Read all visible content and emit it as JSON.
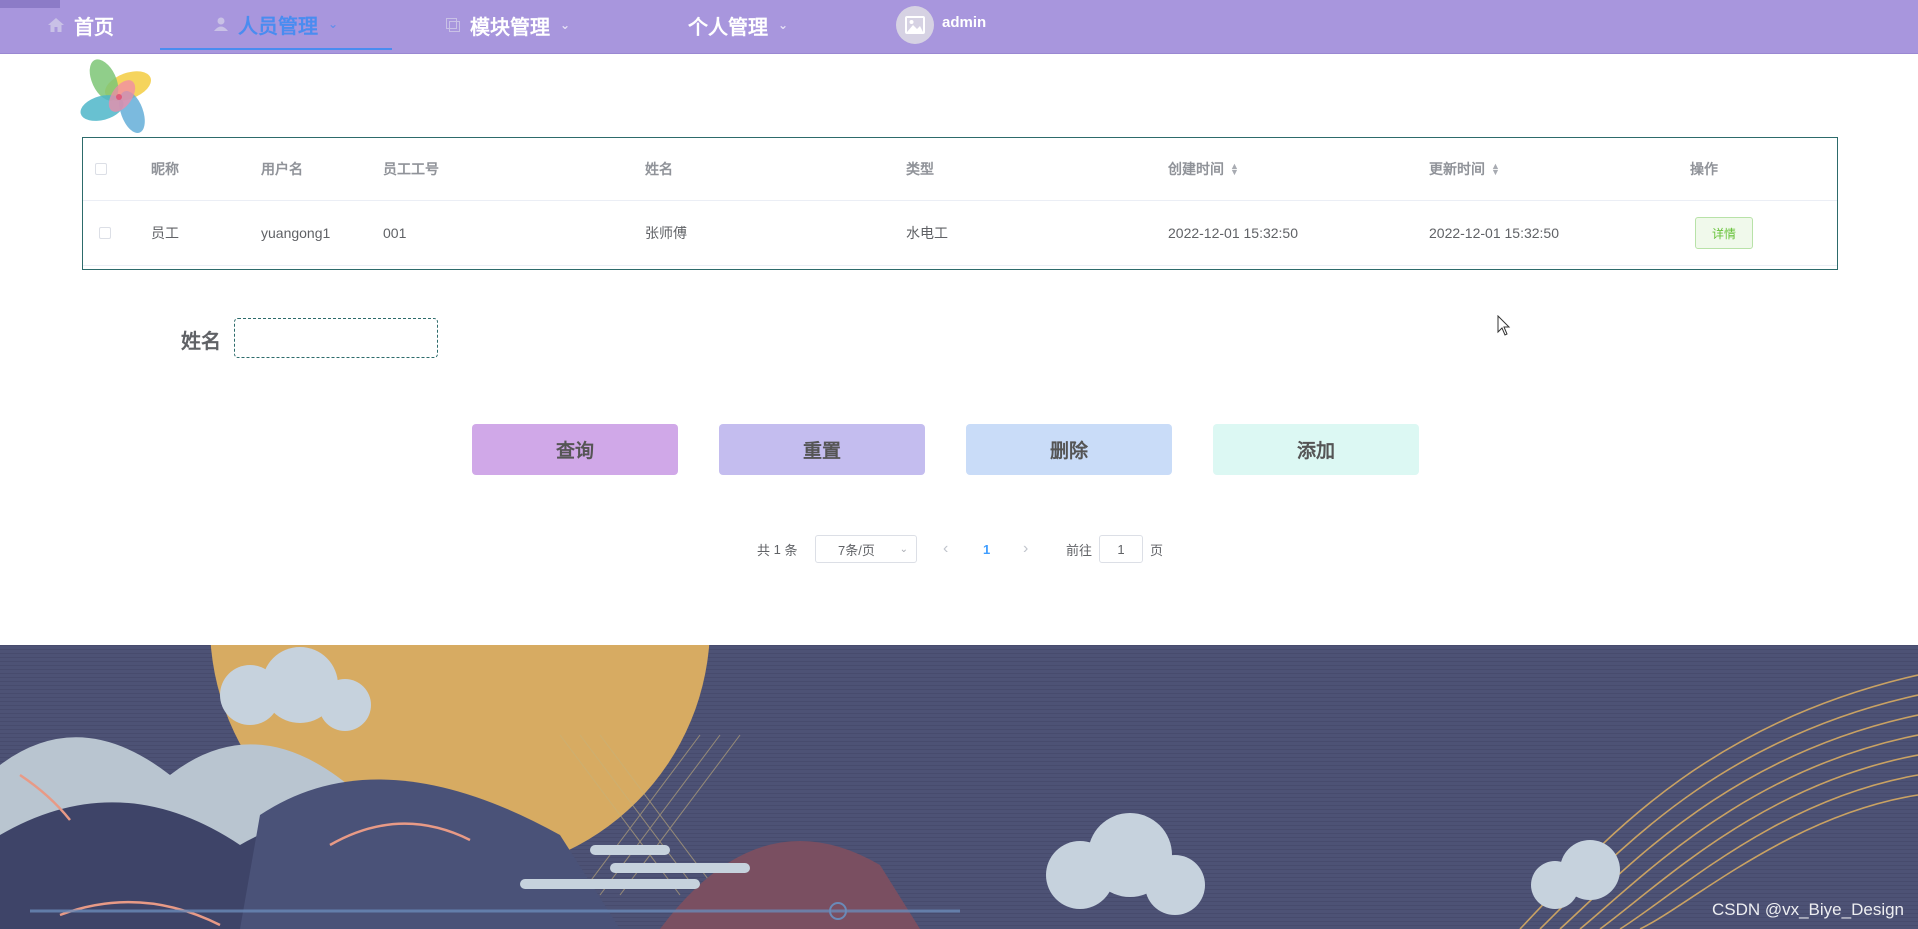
{
  "nav": {
    "items": [
      {
        "label": "首页",
        "icon": "home-icon"
      },
      {
        "label": "人员管理",
        "icon": "user-icon",
        "active": true
      },
      {
        "label": "模块管理",
        "icon": "module-icon"
      },
      {
        "label": "个人管理",
        "icon": ""
      }
    ],
    "user": "admin",
    "colors": {
      "bg": "#a896dd",
      "active": "#4a8cf0"
    }
  },
  "table": {
    "columns": [
      "昵称",
      "用户名",
      "员工工号",
      "姓名",
      "类型",
      "创建时间",
      "更新时间",
      "操作"
    ],
    "rows": [
      {
        "nickname": "员工",
        "username": "yuangong1",
        "emp_no": "001",
        "name": "张师傅",
        "type": "水电工",
        "created": "2022-12-01 15:32:50",
        "updated": "2022-12-01 15:32:50",
        "action": "详情"
      }
    ]
  },
  "search": {
    "label": "姓名",
    "value": "",
    "placeholder": ""
  },
  "buttons": {
    "query": "查询",
    "reset": "重置",
    "delete": "删除",
    "add": "添加",
    "colors": {
      "query": "#d0a8e8",
      "reset": "#c4bdef",
      "delete": "#c9dcf8",
      "add": "#dcf8f3"
    }
  },
  "pagination": {
    "total_prefix": "共",
    "total": "1",
    "total_suffix": "条",
    "page_size": "7条/页",
    "current_page": "1",
    "goto_prefix": "前往",
    "goto_value": "1",
    "goto_suffix": "页"
  },
  "footer": {
    "watermark": "CSDN @vx_Biye_Design"
  }
}
